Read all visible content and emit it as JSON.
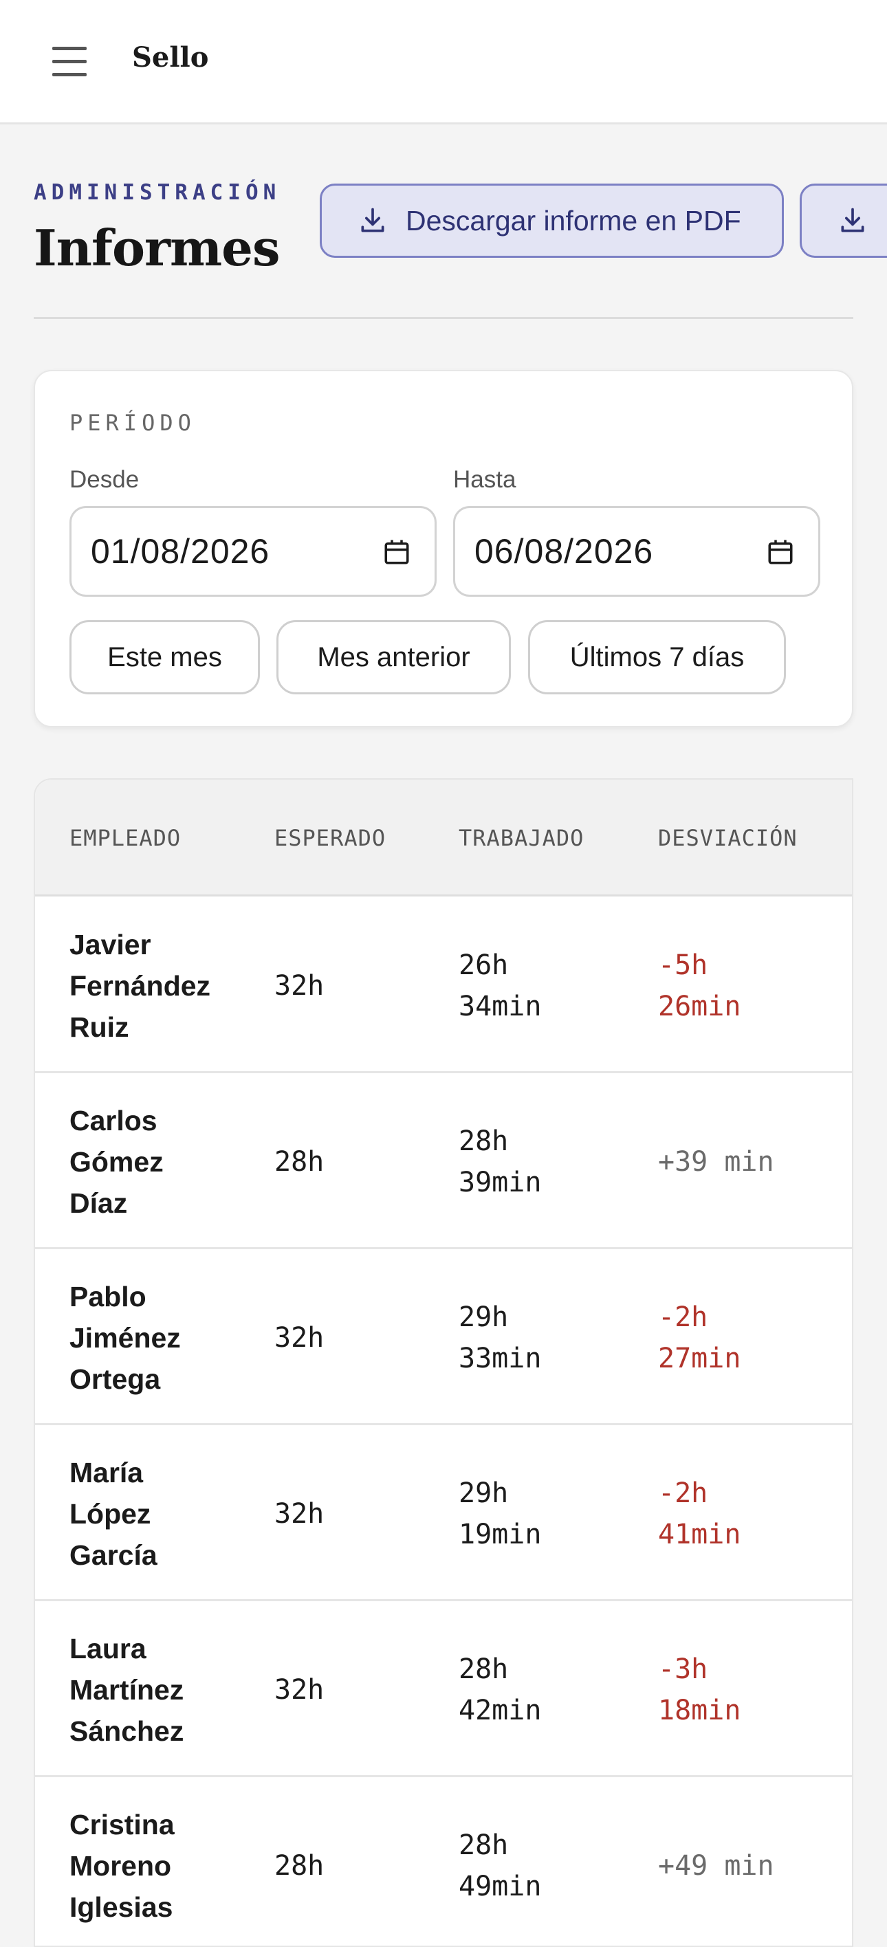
{
  "header": {
    "brand": "Sello"
  },
  "page": {
    "eyebrow": "ADMINISTRACIÓN",
    "title": "Informes",
    "download_pdf_label": "Descargar informe en PDF"
  },
  "period": {
    "label": "PERÍODO",
    "from_label": "Desde",
    "from_value": "01/08/2026",
    "to_label": "Hasta",
    "to_value": "06/08/2026",
    "presets": [
      "Este mes",
      "Mes anterior",
      "Últimos 7 días"
    ]
  },
  "table": {
    "columns": [
      "EMPLEADO",
      "ESPERADO",
      "TRABAJADO",
      "DESVIACIÓN"
    ],
    "rows": [
      {
        "name": [
          "Javier",
          "Fernández",
          "Ruiz"
        ],
        "expected": "32h",
        "worked": [
          "26h",
          "34min"
        ],
        "deviation": [
          "-5h",
          "26min"
        ],
        "status": "negative"
      },
      {
        "name": [
          "Carlos",
          "Gómez",
          "Díaz"
        ],
        "expected": "28h",
        "worked": [
          "28h",
          "39min"
        ],
        "deviation": [
          "+39 min"
        ],
        "status": "positive"
      },
      {
        "name": [
          "Pablo",
          "Jiménez",
          "Ortega"
        ],
        "expected": "32h",
        "worked": [
          "29h",
          "33min"
        ],
        "deviation": [
          "-2h",
          "27min"
        ],
        "status": "negative"
      },
      {
        "name": [
          "María",
          "López",
          "García"
        ],
        "expected": "32h",
        "worked": [
          "29h",
          "19min"
        ],
        "deviation": [
          "-2h",
          "41min"
        ],
        "status": "negative"
      },
      {
        "name": [
          "Laura",
          "Martínez",
          "Sánchez"
        ],
        "expected": "32h",
        "worked": [
          "28h",
          "42min"
        ],
        "deviation": [
          "-3h",
          "18min"
        ],
        "status": "negative"
      },
      {
        "name": [
          "Cristina",
          "Moreno",
          "Iglesias"
        ],
        "expected": "28h",
        "worked": [
          "28h",
          "49min"
        ],
        "deviation": [
          "+49 min"
        ],
        "status": "positive"
      }
    ]
  },
  "colors": {
    "accent": "#3c3f86",
    "negative": "#b0332a",
    "positive": "#6b6b6b"
  },
  "icons": {
    "menu": "hamburger-menu-icon",
    "download": "download-icon",
    "calendar": "calendar-icon"
  }
}
